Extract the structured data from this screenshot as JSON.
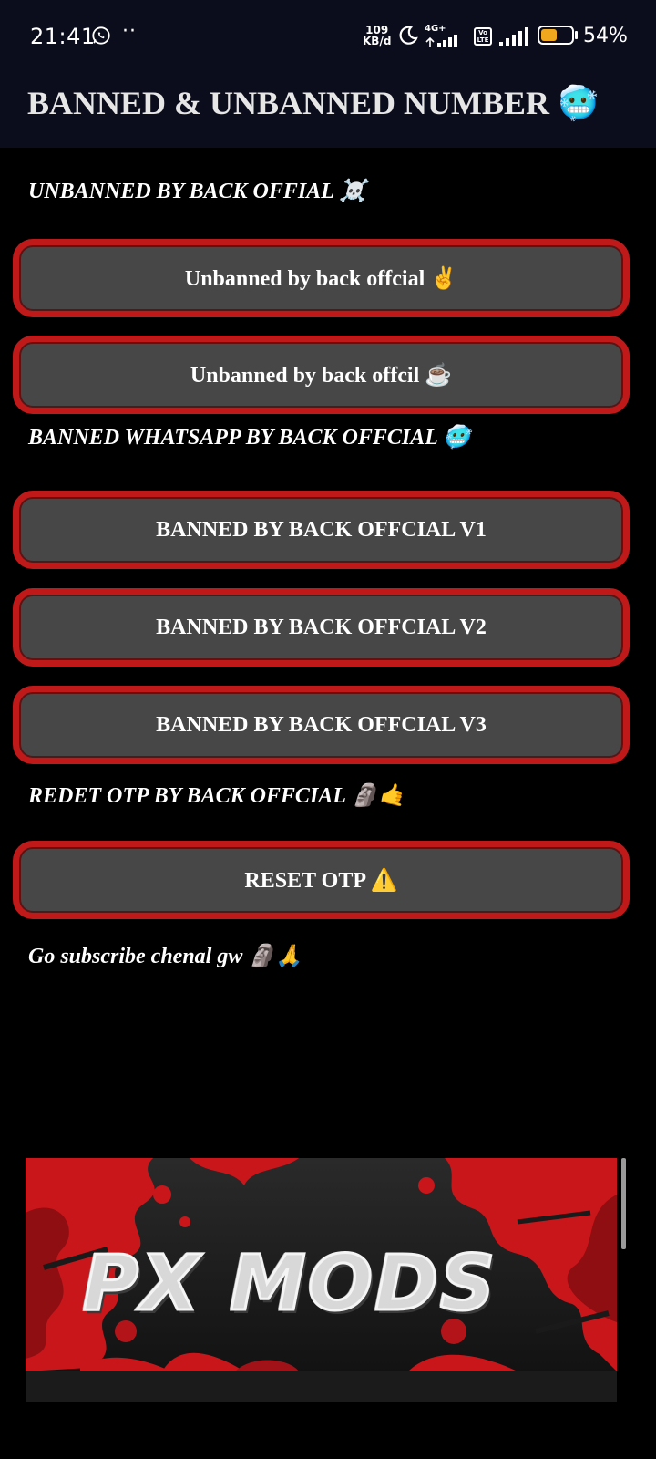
{
  "status_bar": {
    "time": "21:41",
    "dots": "··",
    "speed_value": "109",
    "speed_unit": "KB/d",
    "network": "4G+",
    "volte": "Vo LTE",
    "battery_pct": "54%",
    "battery_level": 0.54,
    "battery_color": "#f0a91e"
  },
  "header": {
    "title": "BANNED & UNBANNED NUMBER 🥶"
  },
  "sections": {
    "unbanned_label": "UNBANNED BY BACK OFFIAL ☠️",
    "banned_label": "BANNED WHATSAPP BY BACK OFFCIAL 🥶",
    "otp_label": "REDET OTP BY BACK OFFCIAL 🗿🤙"
  },
  "buttons": {
    "unbanned_1": "Unbanned by back offcial ✌️",
    "unbanned_2": "Unbanned by back offcil ☕",
    "banned_v1": "BANNED BY BACK OFFCIAL V1",
    "banned_v2": "BANNED BY BACK OFFCIAL V2",
    "banned_v3": "BANNED BY BACK OFFCIAL V3",
    "reset_otp": "RESET OTP ⚠️"
  },
  "footer": {
    "subscribe_text": "Go subscribe chenal gw 🗿🙏"
  },
  "banner": {
    "text": "PX MODS"
  },
  "colors": {
    "accent_border": "#c0191a",
    "button_bg": "#474747",
    "bar_bg": "#0b0d1c"
  }
}
